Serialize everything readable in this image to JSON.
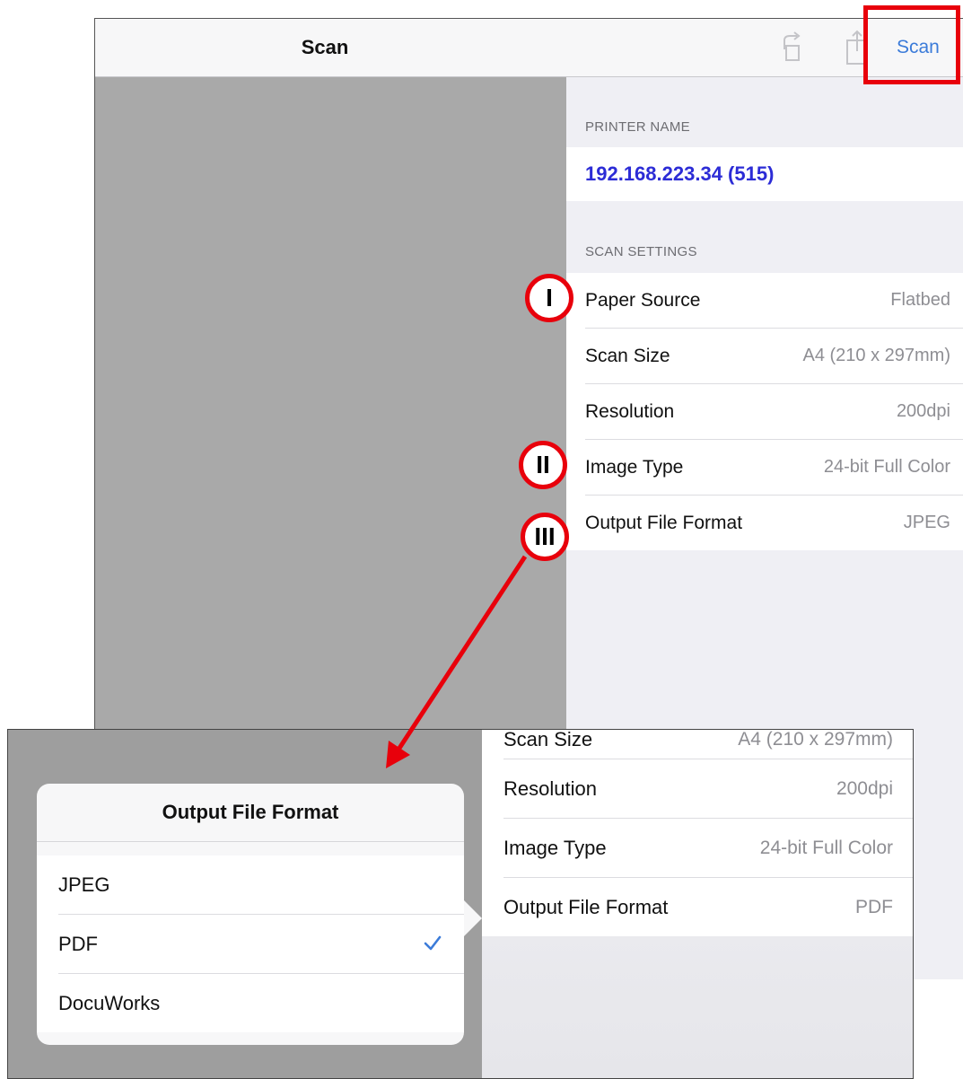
{
  "navbar": {
    "title": "Scan",
    "scan_button": "Scan",
    "rotate_icon": "rotate-icon",
    "share_icon": "share-icon"
  },
  "printer_section": {
    "header": "PRINTER NAME",
    "printer_name": "192.168.223.34  (515)"
  },
  "scan_settings": {
    "header": "SCAN SETTINGS",
    "rows": [
      {
        "label": "Paper Source",
        "value": "Flatbed"
      },
      {
        "label": "Scan Size",
        "value": "A4 (210 x 297mm)"
      },
      {
        "label": "Resolution",
        "value": "200dpi"
      },
      {
        "label": "Image Type",
        "value": "24-bit Full Color"
      },
      {
        "label": "Output File Format",
        "value": "JPEG"
      }
    ]
  },
  "markers": [
    "I",
    "II",
    "III"
  ],
  "inset": {
    "rows": [
      {
        "label": "Scan Size",
        "value": "A4 (210 x 297mm)"
      },
      {
        "label": "Resolution",
        "value": "200dpi"
      },
      {
        "label": "Image Type",
        "value": "24-bit Full Color"
      },
      {
        "label": "Output File Format",
        "value": "PDF"
      }
    ],
    "popover": {
      "title": "Output File Format",
      "options": [
        {
          "label": "JPEG",
          "selected": false
        },
        {
          "label": "PDF",
          "selected": true
        },
        {
          "label": "DocuWorks",
          "selected": false
        }
      ],
      "check_icon": "checkmark-icon"
    }
  },
  "colors": {
    "accent": "#3b7bd9",
    "printer_name": "#2c2cd6",
    "annotation_red": "#e8000b",
    "preview_gray": "#a9a9a9"
  }
}
